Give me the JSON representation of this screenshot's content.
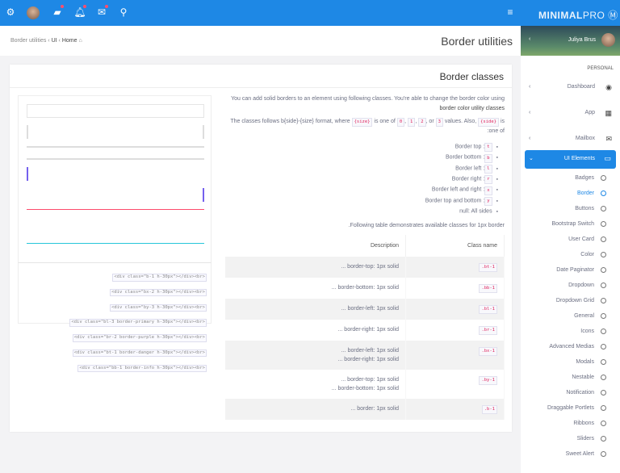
{
  "topbar": {
    "icons": [
      "gear-icon",
      "avatar",
      "chat-icon",
      "bell-icon",
      "mail-icon",
      "search-icon"
    ],
    "menu_icon": "≡"
  },
  "breadcrumb": {
    "items": [
      "Border utilities",
      "UI",
      "Home"
    ]
  },
  "page_title": "Border utilities",
  "card": {
    "title": "Border classes"
  },
  "demo_code": [
    "<div class=\"b-1 h-30px\"></div><br>",
    "<div class=\"bx-2 h-30px\"></div><br>",
    "<div class=\"by-3 h-30px\"></div><br>",
    "<div class=\"bl-3 border-primary h-30px\"></div><br>",
    "<div class=\"br-2 border-purple h-30px\"></div><br>",
    "<div class=\"bt-1 border-danger h-30px\"></div><br>",
    "<div class=\"bb-1 border-info h-30px\"></div><br>"
  ],
  "intro": {
    "p1a": "You can add solid borders to an element using following classes. You're able to change the border color using ",
    "p1b": "border color utility classes",
    "p2a": "The classes follows b{side}-{size} format, where ",
    "size": "{size}",
    "p2b": " is one of ",
    "v0": "0",
    "v1": "1",
    "v2": "2",
    "or": ", or ",
    "v3": "3",
    "p2c": " values. Also, ",
    "side": "{side}",
    "p2d": " is one of:"
  },
  "sides": [
    {
      "code": "t",
      "label": ": Border top"
    },
    {
      "code": "b",
      "label": ": Border bottom"
    },
    {
      "code": "l",
      "label": ": Border left"
    },
    {
      "code": "r",
      "label": ": Border right"
    },
    {
      "code": "x",
      "label": ": Border left and right"
    },
    {
      "code": "y",
      "label": ": Border top and bottom"
    },
    {
      "code": "",
      "label": "null: All sides"
    }
  ],
  "table_intro": "Following table demonstrates available classes for 1px border.",
  "table": {
    "headers": [
      "Class name",
      "Description"
    ],
    "rows": [
      {
        "cls": ".bt-1",
        "desc": [
          "border-top: 1px solid ..."
        ]
      },
      {
        "cls": ".bb-1",
        "desc": [
          "border-bottom: 1px solid ..."
        ]
      },
      {
        "cls": ".bl-1",
        "desc": [
          "border-left: 1px solid ..."
        ]
      },
      {
        "cls": ".br-1",
        "desc": [
          "border-right: 1px solid ..."
        ]
      },
      {
        "cls": ".bx-1",
        "desc": [
          "border-left: 1px solid ...",
          "border-right: 1px solid ..."
        ]
      },
      {
        "cls": ".by-1",
        "desc": [
          "border-top: 1px solid ...",
          "border-bottom: 1px solid ..."
        ]
      },
      {
        "cls": ".b-1",
        "desc": [
          "border: 1px solid ..."
        ]
      }
    ]
  },
  "sidebar": {
    "logo_bold": "MINIMAL",
    "logo_light": "PRO",
    "user": "Juliya Brus",
    "section": "PERSONAL",
    "menu": [
      {
        "label": "Dashboard",
        "icon": "◉"
      },
      {
        "label": "App",
        "icon": "▦"
      },
      {
        "label": "Mailbox",
        "icon": "✉"
      }
    ],
    "active": {
      "label": "UI Elements",
      "icon": "▭"
    },
    "subitems": [
      "Badges",
      "Border",
      "Buttons",
      "Bootstrap Switch",
      "User Card",
      "Color",
      "Date Paginator",
      "Dropdown",
      "Dropdown Grid",
      "General",
      "Icons",
      "Advanced Medias",
      "Modals",
      "Nestable",
      "Notification",
      "Draggable Portlets",
      "Ribbons",
      "Sliders",
      "Sweet Alert"
    ],
    "current": "Border"
  },
  "colors": {
    "primary": "#1e88e5",
    "danger": "#fc4b6c",
    "purple": "#7460ee",
    "info": "#26c6da"
  }
}
